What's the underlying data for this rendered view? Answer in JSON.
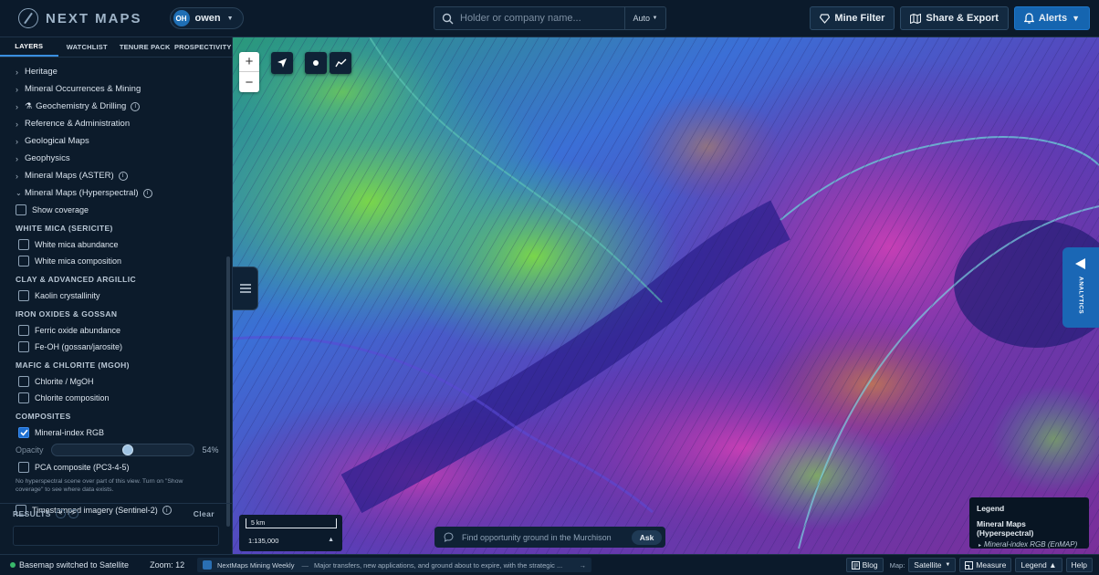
{
  "brand": {
    "name": "NEXT MAPS"
  },
  "user": {
    "initials": "OH",
    "name": "owen"
  },
  "search": {
    "placeholder": "Holder or company name...",
    "mode": "Auto"
  },
  "top_actions": [
    {
      "label": "Mine Filter",
      "icon": "diamond-icon"
    },
    {
      "label": "Share & Export",
      "icon": "map-icon"
    },
    {
      "label": "Alerts",
      "icon": "bell-icon",
      "caret": "▼"
    }
  ],
  "tabs": [
    "LAYERS",
    "WATCHLIST",
    "TENURE PACK",
    "PROSPECTIVITY"
  ],
  "layer_groups": [
    {
      "label": "Heritage"
    },
    {
      "label": "Mineral Occurrences & Mining"
    },
    {
      "label": "Geochemistry & Drilling"
    },
    {
      "label": "Reference & Administration"
    },
    {
      "label": "Geological Maps"
    },
    {
      "label": "Geophysics"
    },
    {
      "label": "Mineral Maps (ASTER)"
    },
    {
      "label": "Mineral Maps (Hyperspectral)"
    }
  ],
  "show_coverage": {
    "label": "Show coverage",
    "checked": false
  },
  "sections": {
    "white_mica": {
      "title": "WHITE MICA (SERICITE)",
      "items": [
        {
          "label": "White mica abundance",
          "checked": false
        },
        {
          "label": "White mica composition",
          "checked": false
        }
      ]
    },
    "clay": {
      "title": "CLAY & ADVANCED ARGILLIC",
      "items": [
        {
          "label": "Kaolin crystallinity",
          "checked": false
        }
      ]
    },
    "iron": {
      "title": "IRON OXIDES & GOSSAN",
      "items": [
        {
          "label": "Ferric oxide abundance",
          "checked": false
        },
        {
          "label": "Fe-OH (gossan/jarosite)",
          "checked": false
        }
      ]
    },
    "mafic": {
      "title": "MAFIC & CHLORITE (MGOH)",
      "items": [
        {
          "label": "Chlorite / MgOH",
          "checked": false
        },
        {
          "label": "Chlorite composition",
          "checked": false
        }
      ]
    },
    "composites": {
      "title": "COMPOSITES",
      "items": [
        {
          "label": "Mineral-index RGB",
          "checked": true
        },
        {
          "label": "PCA composite (PC3-4-5)",
          "checked": false
        }
      ]
    }
  },
  "opacity": {
    "label": "Opacity",
    "value": 54,
    "display": "54%"
  },
  "coverage_note": "No hyperspectral scene over part of this view. Turn on \"Show coverage\" to see where data exists.",
  "timestamped": {
    "label": "Timestamped imagery (Sentinel-2)",
    "checked": false
  },
  "results": {
    "title": "RESULTS",
    "prev": "<",
    "next": ">",
    "clear": "Clear"
  },
  "map": {
    "zoom_in": "+",
    "zoom_out": "−",
    "analytics_label": "ANALYTICS",
    "scale_label": "5 km",
    "scale_ratio": "1:135,000",
    "ask_placeholder": "Find opportunity ground in the Murchison",
    "ask_button": "Ask"
  },
  "legend": {
    "title": "Legend",
    "layer": "Mineral Maps (Hyperspectral)",
    "item": "Mineral-index RGB (EnMAP)"
  },
  "status": {
    "message": "Basemap switched to Satellite",
    "zoom": "Zoom: 12",
    "news_title": "NextMaps Mining Weekly",
    "news_sep": "—",
    "news_text": "Major transfers, new applications, and ground about to expire, with the strategic ...",
    "news_arrow": "→",
    "blog": "Blog",
    "map_label": "Map:",
    "map_value": "Satellite",
    "measure": "Measure",
    "legend": "Legend ▲",
    "help": "Help"
  },
  "colors": {
    "accent": "#1565b0",
    "status_ok": "#39b86b",
    "checkbox_checked": "#1e6fd0"
  }
}
